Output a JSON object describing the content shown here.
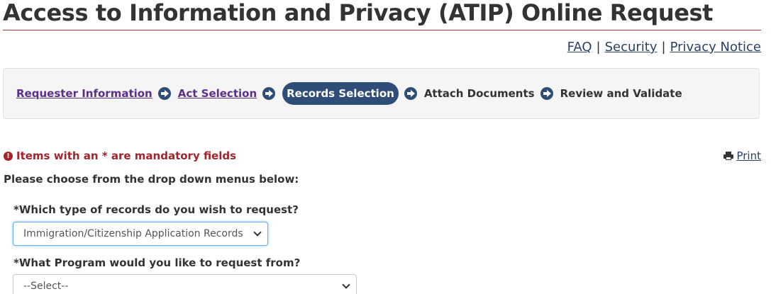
{
  "header": {
    "title": "Access to Information and Privacy (ATIP) Online Request"
  },
  "top_links": [
    {
      "label": "FAQ"
    },
    {
      "label": "Security"
    },
    {
      "label": "Privacy Notice"
    }
  ],
  "top_links_separator": "|",
  "steps": [
    {
      "label": "Requester Information",
      "state": "completed"
    },
    {
      "label": "Act Selection",
      "state": "completed"
    },
    {
      "label": "Records Selection",
      "state": "current"
    },
    {
      "label": "Attach Documents",
      "state": "upcoming"
    },
    {
      "label": "Review and Validate",
      "state": "upcoming"
    }
  ],
  "notice": {
    "mandatory_text": "Items with an * are mandatory fields",
    "print_label": "Print",
    "exclaim_glyph": "!"
  },
  "form": {
    "instructions": "Please choose from the drop down menus below:",
    "record_type_label": "*Which type of records do you wish to request?",
    "record_type_value": "Immigration/Citizenship Application Records",
    "program_label": "*What Program would you like to request from?",
    "program_value": "--Select--"
  },
  "colors": {
    "title_rule": "#af3c43",
    "link": "#284162",
    "visited_link": "#5c2f8a",
    "current_step_bg": "#2e4d77",
    "mandatory": "#a3242b"
  }
}
